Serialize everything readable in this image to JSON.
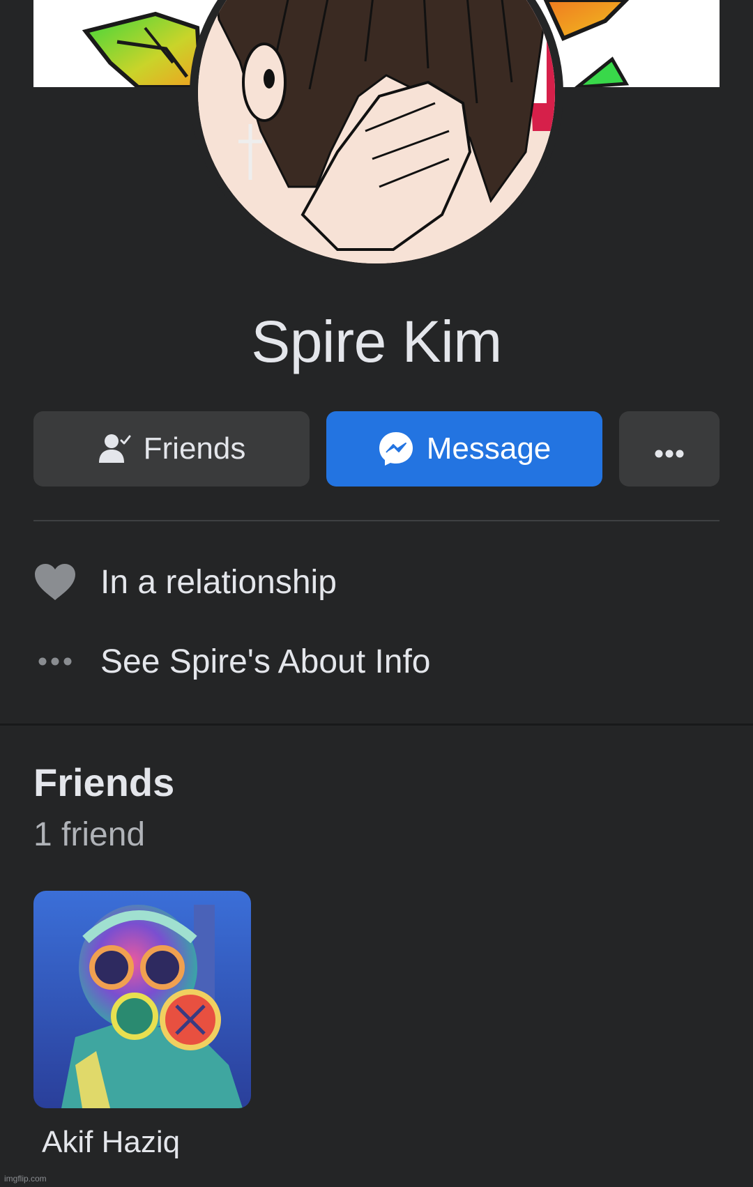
{
  "cover": {
    "image": "cover-photo"
  },
  "profile": {
    "avatar": "profile-picture",
    "name": "Spire Kim"
  },
  "actions": {
    "friends_label": "Friends",
    "friends_icon": "person-check-icon",
    "message_label": "Message",
    "message_icon": "messenger-icon",
    "more_icon": "more-dots-icon"
  },
  "info": {
    "relationship": "In a relationship",
    "relationship_icon": "heart-icon",
    "about": "See Spire's About Info",
    "about_icon": "more-dots-icon"
  },
  "friends_section": {
    "title": "Friends",
    "count": "1 friend",
    "items": [
      {
        "name": "Akif Haziq",
        "photo": "friend-photo"
      }
    ]
  },
  "watermark": "imgflip.com",
  "colors": {
    "background": "#242526",
    "button_secondary": "#3a3b3c",
    "button_primary": "#2374e1",
    "text_primary": "#e4e6eb",
    "text_secondary": "#b0b3b8",
    "icon_gray": "#8a8d91"
  }
}
